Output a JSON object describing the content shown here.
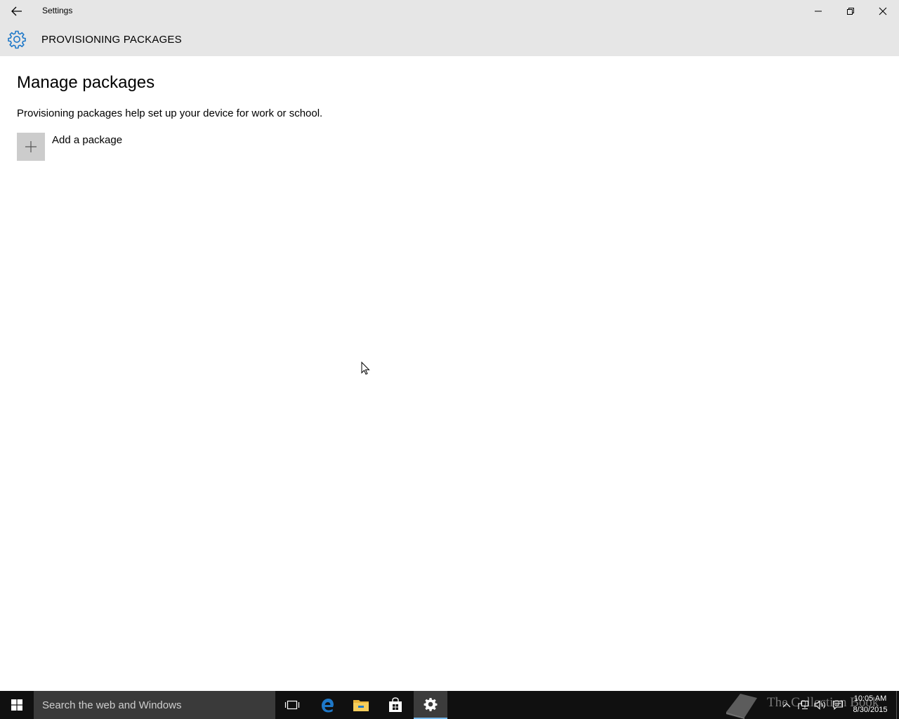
{
  "window": {
    "title": "Settings"
  },
  "header": {
    "page_title": "PROVISIONING PACKAGES"
  },
  "main": {
    "heading": "Manage packages",
    "description": "Provisioning packages help set up your device for work or school.",
    "add_package_label": "Add a package"
  },
  "taskbar": {
    "search_placeholder": "Search the web and Windows",
    "apps": [
      "task-view-icon",
      "edge-icon",
      "file-explorer-icon",
      "store-icon",
      "settings-icon"
    ],
    "active_app": "settings-icon",
    "watermark_text": "The Collection Book",
    "clock": {
      "time": "10:05 AM",
      "date": "8/30/2015"
    }
  },
  "colors": {
    "chrome_gray": "#e6e6e6",
    "accent": "#1e78c8",
    "tile_gray": "#cccccc",
    "taskbar": "#101010"
  }
}
